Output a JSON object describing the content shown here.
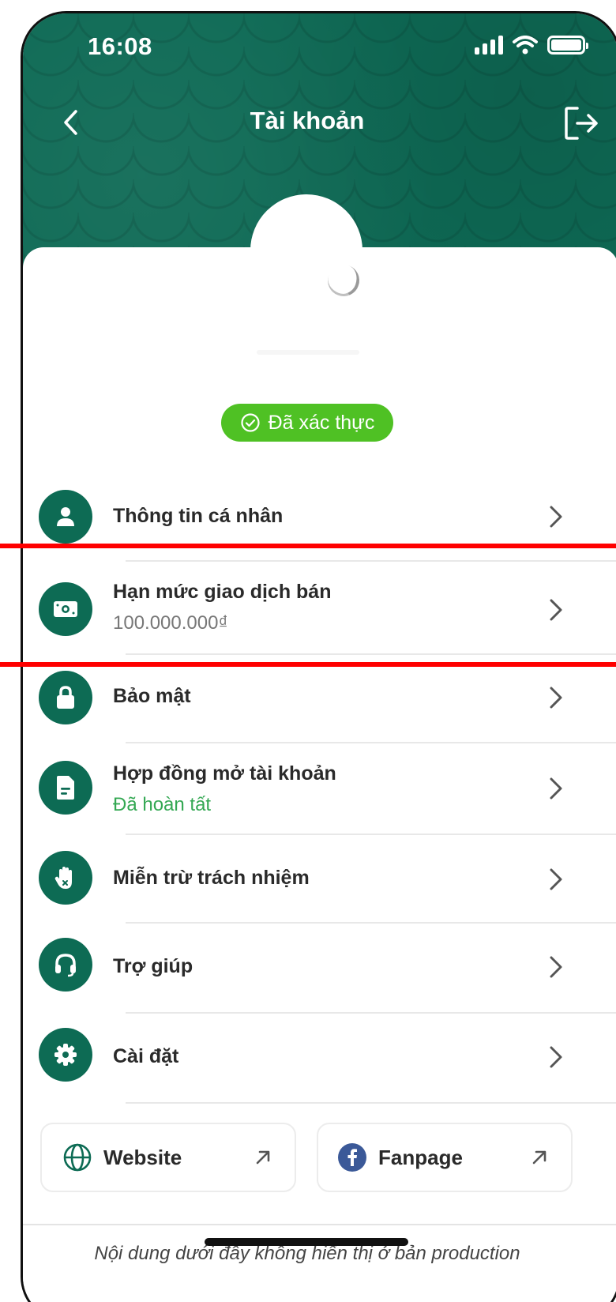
{
  "status_bar": {
    "time": "16:08"
  },
  "header": {
    "title": "Tài khoản"
  },
  "profile": {
    "verified_label": "Đã xác thực"
  },
  "menu": [
    {
      "title": "Thông tin cá nhân",
      "subtitle": "",
      "icon": "person-icon"
    },
    {
      "title": "Hạn mức giao dịch bán",
      "subtitle": "100.000.000₫",
      "icon": "money-icon"
    },
    {
      "title": "Bảo mật",
      "subtitle": "",
      "icon": "lock-icon"
    },
    {
      "title": "Hợp đồng mở tài khoản",
      "subtitle": "Đã hoàn tất",
      "icon": "document-icon"
    },
    {
      "title": "Miễn trừ trách nhiệm",
      "subtitle": "",
      "icon": "hand-stop-icon"
    },
    {
      "title": "Trợ giúp",
      "subtitle": "",
      "icon": "headset-icon"
    },
    {
      "title": "Cài đặt",
      "subtitle": "",
      "icon": "gear-icon"
    }
  ],
  "links": {
    "website": "Website",
    "fanpage": "Fanpage"
  },
  "footer": {
    "note": "Nội dung dưới đây không hiển thị ở bản production"
  },
  "colors": {
    "brand": "#0d6b54",
    "verified": "#4fc124",
    "success_text": "#34a853",
    "highlight": "#ff0000"
  }
}
